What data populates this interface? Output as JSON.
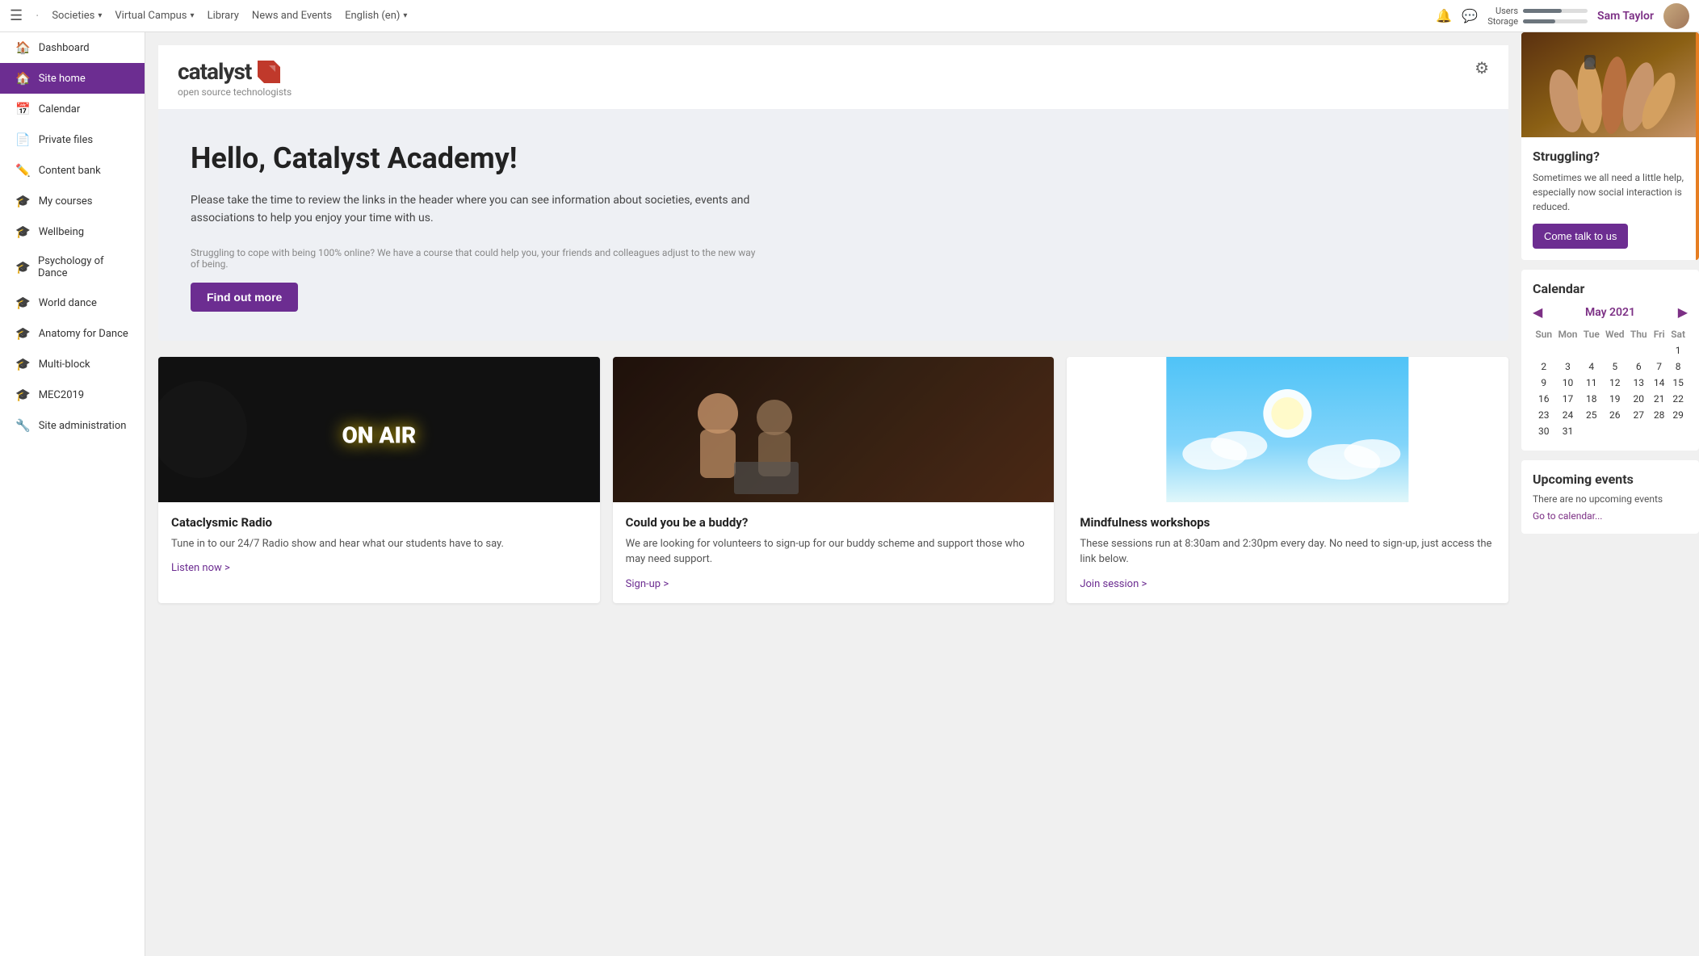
{
  "topnav": {
    "societies_label": "Societies",
    "virtual_campus_label": "Virtual Campus",
    "library_label": "Library",
    "news_events_label": "News and Events",
    "language_label": "English (en)",
    "users_label": "Users",
    "storage_label": "Storage",
    "users_fill_pct": 60,
    "storage_fill_pct": 50,
    "user_name": "Sam Taylor"
  },
  "sidebar": {
    "items": [
      {
        "id": "dashboard",
        "label": "Dashboard",
        "icon": "🏠"
      },
      {
        "id": "site-home",
        "label": "Site home",
        "icon": "🏠",
        "active": true
      },
      {
        "id": "calendar",
        "label": "Calendar",
        "icon": "📅"
      },
      {
        "id": "private-files",
        "label": "Private files",
        "icon": "📄"
      },
      {
        "id": "content-bank",
        "label": "Content bank",
        "icon": "✏️"
      },
      {
        "id": "my-courses",
        "label": "My courses",
        "icon": "🎓"
      },
      {
        "id": "wellbeing",
        "label": "Wellbeing",
        "icon": "🎓"
      },
      {
        "id": "psychology-of-dance",
        "label": "Psychology of Dance",
        "icon": "🎓"
      },
      {
        "id": "world-dance",
        "label": "World dance",
        "icon": "🎓"
      },
      {
        "id": "anatomy-for-dance",
        "label": "Anatomy for Dance",
        "icon": "🎓"
      },
      {
        "id": "multi-block",
        "label": "Multi-block",
        "icon": "🎓"
      },
      {
        "id": "mec2019",
        "label": "MEC2019",
        "icon": "🎓"
      },
      {
        "id": "site-admin",
        "label": "Site administration",
        "icon": "🔧"
      }
    ]
  },
  "brand": {
    "name": "catalyst",
    "tagline": "open source technologists"
  },
  "hero": {
    "title": "Hello, Catalyst Academy!",
    "text": "Please take the time to review the links in the header where you can see information about societies, events and associations to help you enjoy your time with us.",
    "struggle_text": "Struggling to cope with being 100% online? We have a course that could help you, your friends and colleagues adjust to the new way of being.",
    "find_out_more": "Find out more"
  },
  "cards": [
    {
      "id": "radio",
      "title": "Cataclysmic Radio",
      "text": "Tune in to our 24/7 Radio show and hear what our students have to say.",
      "link": "Listen now >",
      "type": "onair"
    },
    {
      "id": "buddy",
      "title": "Could you be a buddy?",
      "text": "We are looking for volunteers to sign-up for our buddy scheme and support those who may need support.",
      "link": "Sign-up >",
      "type": "buddy"
    },
    {
      "id": "mindfulness",
      "title": "Mindfulness workshops",
      "text": "These sessions run at 8:30am and 2:30pm every day. No need to sign-up, just access the link below.",
      "link": "Join session >",
      "type": "sky"
    }
  ],
  "struggling_panel": {
    "title": "Struggling?",
    "text": "Sometimes we all need a little help, especially now social interaction is reduced.",
    "cta": "Come talk to us"
  },
  "calendar": {
    "title": "Calendar",
    "month": "May 2021",
    "days_header": [
      "Sun",
      "Mon",
      "Tue",
      "Wed",
      "Thu",
      "Fri",
      "Sat"
    ],
    "weeks": [
      [
        "",
        "",
        "",
        "",
        "",
        "",
        "1"
      ],
      [
        "2",
        "3",
        "4",
        "5",
        "6",
        "7",
        "8"
      ],
      [
        "9",
        "10",
        "11",
        "12",
        "13",
        "14",
        "15"
      ],
      [
        "16",
        "17",
        "18",
        "19",
        "20",
        "21",
        "22"
      ],
      [
        "23",
        "24",
        "25",
        "26",
        "27",
        "28",
        "29"
      ],
      [
        "30",
        "31",
        "",
        "",
        "",
        "",
        ""
      ]
    ]
  },
  "upcoming_events": {
    "title": "Upcoming events",
    "empty_text": "There are no upcoming events",
    "calendar_link": "Go to calendar..."
  }
}
